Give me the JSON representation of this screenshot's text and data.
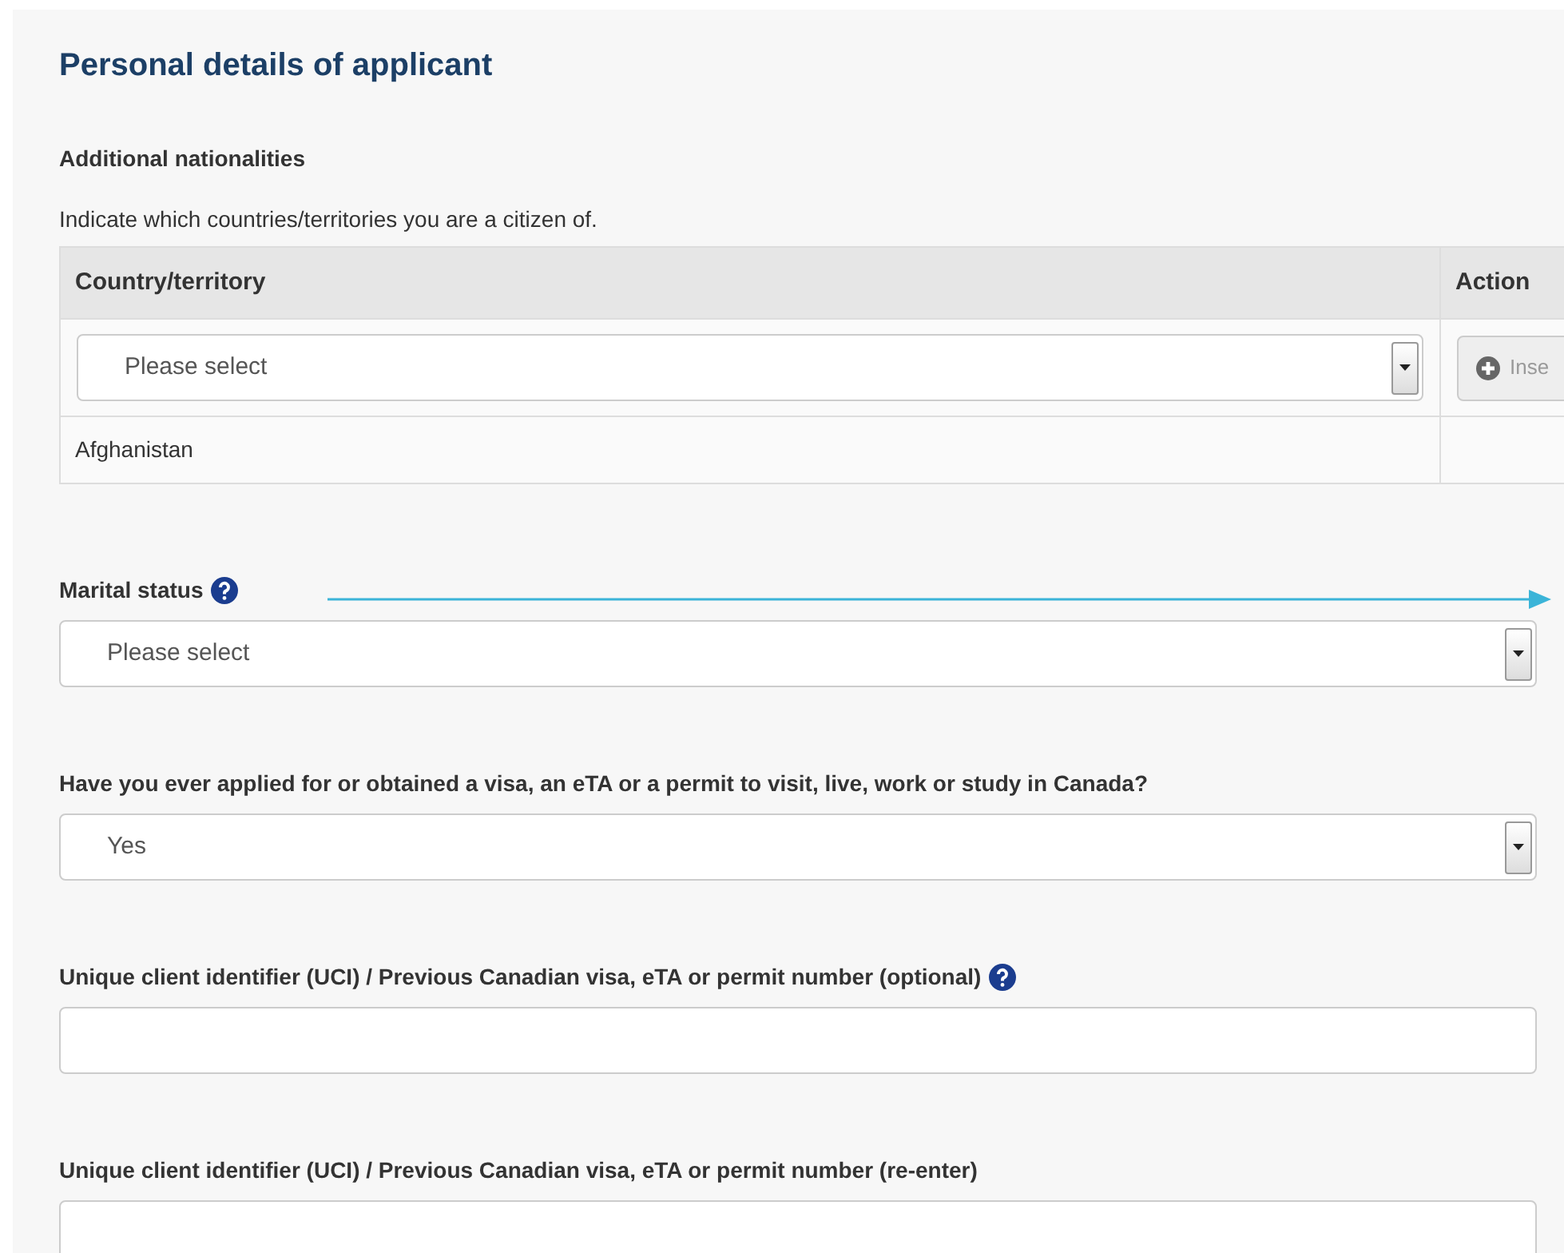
{
  "section_title": "Personal details of applicant",
  "nationalities": {
    "label": "Additional nationalities",
    "hint": "Indicate which countries/territories you are a citizen of.",
    "table": {
      "columns": [
        "Country/territory",
        "Action"
      ],
      "input_row": {
        "select": {
          "value": "Please select"
        },
        "button": {
          "label": "Inse",
          "disabled": true
        }
      },
      "rows": [
        {
          "country": "Afghanistan"
        }
      ]
    }
  },
  "fields": [
    {
      "kind": "select",
      "label": "Marital status",
      "help": true,
      "value": "Please select"
    },
    {
      "kind": "select",
      "label": "Have you ever applied for or obtained a visa, an eTA or a permit to visit, live, work or study in Canada?",
      "help": false,
      "value": "Yes"
    },
    {
      "kind": "text",
      "label": "Unique client identifier (UCI) / Previous Canadian visa, eTA or permit number (optional)",
      "help": true
    },
    {
      "kind": "text",
      "label": "Unique client identifier (UCI) / Previous Canadian visa, eTA or permit number (re-enter)",
      "help": false
    }
  ]
}
